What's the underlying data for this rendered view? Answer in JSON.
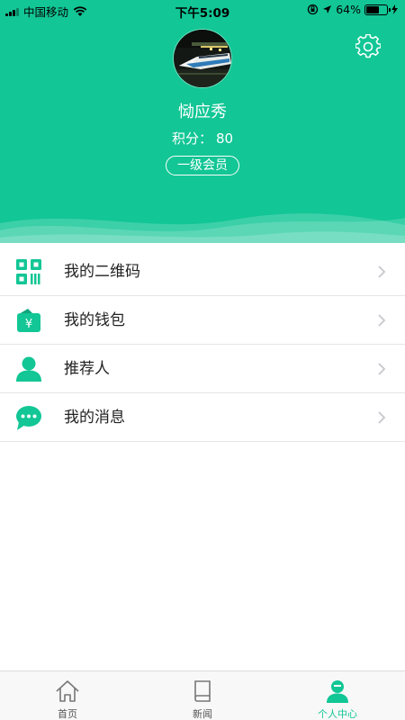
{
  "status_bar": {
    "carrier": "中国移动",
    "time": "下午5:09",
    "battery_percent": "64%",
    "battery_level": 0.64
  },
  "profile": {
    "name": "恸应秀",
    "points_label": "积分：",
    "points_value": "80",
    "member_level": "一级会员"
  },
  "menu": {
    "items": [
      {
        "label": "我的二维码",
        "icon": "qr-code-icon"
      },
      {
        "label": "我的钱包",
        "icon": "wallet-icon"
      },
      {
        "label": "推荐人",
        "icon": "person-icon"
      },
      {
        "label": "我的消息",
        "icon": "message-icon"
      }
    ]
  },
  "tabbar": {
    "tabs": [
      {
        "label": "首页",
        "icon": "home-icon"
      },
      {
        "label": "新闻",
        "icon": "book-icon"
      },
      {
        "label": "个人中心",
        "icon": "user-icon"
      }
    ],
    "active_index": 2
  },
  "colors": {
    "brand": "#12c695",
    "divider": "#e5e5e5",
    "chevron": "#c7c7cc"
  }
}
